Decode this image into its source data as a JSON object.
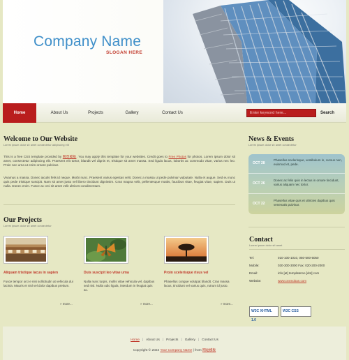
{
  "brand": {
    "company_name": "Company Name",
    "slogan": "SLOGAN HERE"
  },
  "nav": {
    "items": [
      "Home",
      "About Us",
      "Projects",
      "Gallery",
      "Contact Us"
    ],
    "search_placeholder": "Enter keyword here...",
    "search_button": "Search"
  },
  "welcome": {
    "title": "Welcome to Our Website",
    "subtitle": "Lorem ipsum dolor sit amet consectetur adipiscing elit",
    "p1_before": "This is a free CSS template provided by ",
    "p1_link": "网页模板",
    "p1_mid": ". You may apply this template for your websites. Credit goes to ",
    "p1_link2": "Free Photos",
    "p1_after": " for photos. Lorem ipsum dolor sit amet, consectetur adipiscing elit. Praesent elit tortor, blandit vel dignis et, tristique sit amet massa. Sed ligula lacus, lobortis ac commodo vitae, varius nec leo. Proin nec urna ut enim ornare pulvinar.",
    "p2": "Vivamus a massa. Donec iaculis felis id neque. Morbi nunc. Praesent varius egestas velit. Donec a massa ut pede pulvinar vulputate. Nulla et augue. Sed eu nunc quis pede tristique suscipit. Nam sit amet justo vel libero tincidunt dignissim. Cras magna velit, pellentesque mattis, faucibus vitae, feugiat vitae, sapien. Duis ut nulla. Donec enim. Fusce ac orci sit amet velit ultrices condimentum."
  },
  "news": {
    "title": "News & Events",
    "subtitle": "Lorem ipsum dolor sit amet consectetur",
    "items": [
      {
        "date": "OCT 28",
        "text": "Phasellus scelerisque, vestibulum in, cursus non, euismod et, pede."
      },
      {
        "date": "OCT 26",
        "text": "Donec ac felis quis in lectus in ornare tincidunt, varius aliquam nec tortor."
      },
      {
        "date": "OCT 22",
        "text": "Phasellus vitae quis et ultricies dapibus quis venenatis pulvinar."
      }
    ]
  },
  "projects": {
    "title": "Our Projects",
    "subtitle": "Lorem ipsum dolor sit amet consectetur",
    "items": [
      {
        "title": "Aliquam tristique lacus in sapien",
        "text": "Fusce tempor orci e nisi sollicitudin at vehicula dui lacinia. Mauris et nisl vel dolor dapibus pretium.",
        "more": "» more..."
      },
      {
        "title": "Duis suscipit leo vitae urna",
        "text": "Nulla nunc turpis, mollis vitae vehicula vel, dapibus sed nisl. Nulla odio ligula, interdum in feugiat quis ac.",
        "more": "» more..."
      },
      {
        "title": "Proin scelerisque risus vel",
        "text": "Phasellus congue volutpat blandit. Cras massa lacus, tincidunt vel varius quis, rutrum id justo.",
        "more": "» more..."
      }
    ]
  },
  "contact": {
    "title": "Contact",
    "subtitle": "Lorem ipsum dolor sit amet",
    "rows": [
      {
        "label": "Tel:",
        "value": "010-100-1010, 050-500-5050"
      },
      {
        "label": "Mobile:",
        "value": "030-300-3000   Fax: 020-200-2000"
      },
      {
        "label": "Email:",
        "value": "info [at] templatemo [dot] com"
      },
      {
        "label": "Website:",
        "value": "www.cssmoban.com"
      }
    ]
  },
  "badges": {
    "xhtml": "W3C XHTML 1.0",
    "css": "W3C CSS"
  },
  "footer": {
    "links": [
      "Home",
      "About Us",
      "Projects",
      "Gallery",
      "Contact Us"
    ],
    "copy_before": "Copyright © 2024 ",
    "copy_company": "Your Company Name",
    "copy_mid": " | from ",
    "copy_link": "网站模板"
  },
  "colors": {
    "accent": "#b91d1d",
    "title_blue": "#3f8fc9",
    "background": "#e6e8c4"
  }
}
